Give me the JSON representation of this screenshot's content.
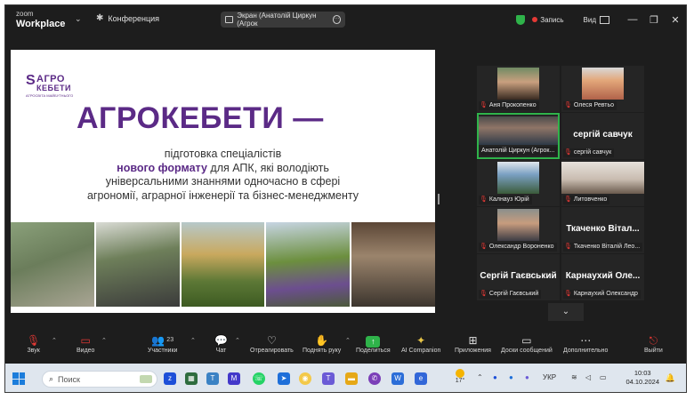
{
  "app": {
    "brand_small": "zoom",
    "brand_large": "Workplace",
    "conference_label": "Конференция"
  },
  "share_pill": {
    "label": "Экран (Анатолій Циркун (Агрок"
  },
  "titlebar": {
    "record_label": "Запись",
    "view_label": "Вид"
  },
  "slide": {
    "logo_line1": "АГРО",
    "logo_line2": "КЕБЕТИ",
    "logo_tagline": "АГРОСВІТА МАЙБУТНЬОГО",
    "headline": "АГРОКЕБЕТИ —",
    "sub_line1": "підготовка спеціалістів",
    "sub_line2_accent": "нового формату",
    "sub_line2_rest": " для АПК, які володіють",
    "sub_line3": "універсальними знаннями одночасно в сфері",
    "sub_line4": "агрономії, аграрної інженерії та бізнес-менеджменту"
  },
  "participants": [
    {
      "label": "Аня Прокопенко",
      "video": true,
      "muted": true
    },
    {
      "label": "Олеся Ревтьо",
      "video": true,
      "muted": true
    },
    {
      "label": "Анатолій Циркун (Агрок...",
      "video": true,
      "muted": false,
      "active": true
    },
    {
      "label": "сергій савчук",
      "big_name": "сергій савчук",
      "video": false,
      "muted": true
    },
    {
      "label": "Калнауз Юрій",
      "video": true,
      "muted": true
    },
    {
      "label": "Литовченко",
      "video": true,
      "muted": true
    },
    {
      "label": "Олександр Вороненко",
      "video": true,
      "muted": true
    },
    {
      "label": "Ткаченко Віталій Лео...",
      "big_name": "Ткаченко Вітал...",
      "video": false,
      "muted": true
    },
    {
      "label": "Сергій Гаєвський",
      "big_name": "Сергій Гаєвський",
      "video": false,
      "muted": true
    },
    {
      "label": "Карнаухий Олександр",
      "big_name": "Карнаухий Оле...",
      "video": false,
      "muted": true
    }
  ],
  "toolbar": {
    "audio": "Звук",
    "video": "Видео",
    "participants": "Участники",
    "participants_count": "23",
    "chat": "Чат",
    "react": "Отреагировать",
    "raise_hand": "Поднять руку",
    "share": "Поделиться",
    "ai": "AI Companion",
    "apps": "Приложения",
    "whiteboards": "Доски сообщений",
    "more": "Дополнительно",
    "leave": "Выйти"
  },
  "taskbar": {
    "search_placeholder": "Поиск",
    "weather_temp": "17°",
    "language": "УКР",
    "time": "10:03",
    "date": "04.10.2024"
  },
  "colors": {
    "brand_purple": "#5b2a86",
    "active_green": "#2fb34a",
    "muted_red": "#e53935"
  }
}
